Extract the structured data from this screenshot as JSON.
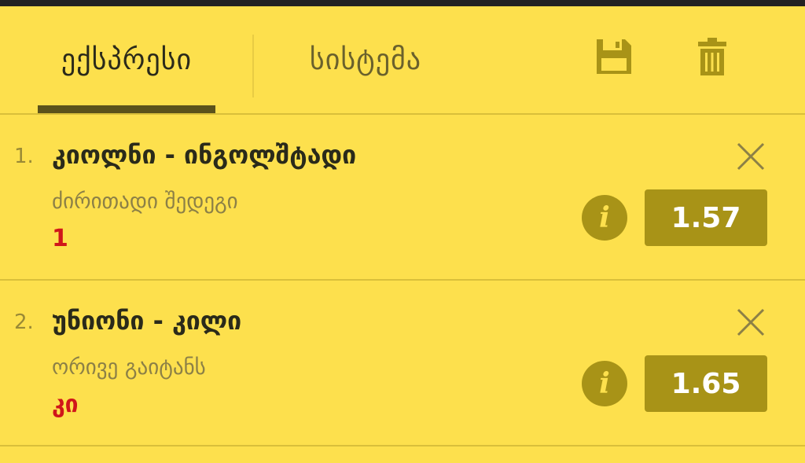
{
  "tabs": [
    {
      "label": "ექსპრესი",
      "active": true
    },
    {
      "label": "სისტემა",
      "active": false
    }
  ],
  "toolbar": {
    "save_icon": "save-icon",
    "trash_icon": "trash-icon"
  },
  "bets": [
    {
      "number": "1.",
      "match": "კიოლნი - ინგოლშტადი",
      "market": "ძირითადი შედეგი",
      "selection": "1",
      "odds": "1.57"
    },
    {
      "number": "2.",
      "match": "უნიონი - კილი",
      "market": "ორივე გაიტანს",
      "selection": "კი",
      "odds": "1.65"
    }
  ],
  "colors": {
    "background": "#fde04d",
    "accent": "#a89317",
    "selection": "#d0161a",
    "text_dark": "#2a2a1a"
  }
}
